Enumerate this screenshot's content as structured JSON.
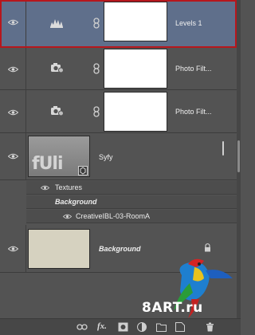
{
  "layers": [
    {
      "name": "Levels 1",
      "type": "adjustment",
      "icon": "levels-icon",
      "selected": true
    },
    {
      "name": "Photo Filt...",
      "type": "adjustment",
      "icon": "photo-filter-icon"
    },
    {
      "name": "Photo Filt...",
      "type": "adjustment",
      "icon": "photo-filter-icon"
    },
    {
      "name": "Syfy",
      "type": "smart-object",
      "thumbnail_text": "fUli",
      "effects": {
        "group_label": "Textures",
        "sub_label": "Background",
        "item_label": "CreativeIBL-03-RoomA"
      }
    },
    {
      "name": "Background",
      "type": "background",
      "locked": true
    }
  ],
  "watermark": {
    "text": "8ART.ru"
  },
  "bottom_bar": {
    "fx_label": "fx."
  },
  "colors": {
    "panel_bg": "#535353",
    "selected_bg": "#5f6f8b",
    "selection_outline": "#b6171d",
    "background_swatch": "#d6d2c0"
  }
}
